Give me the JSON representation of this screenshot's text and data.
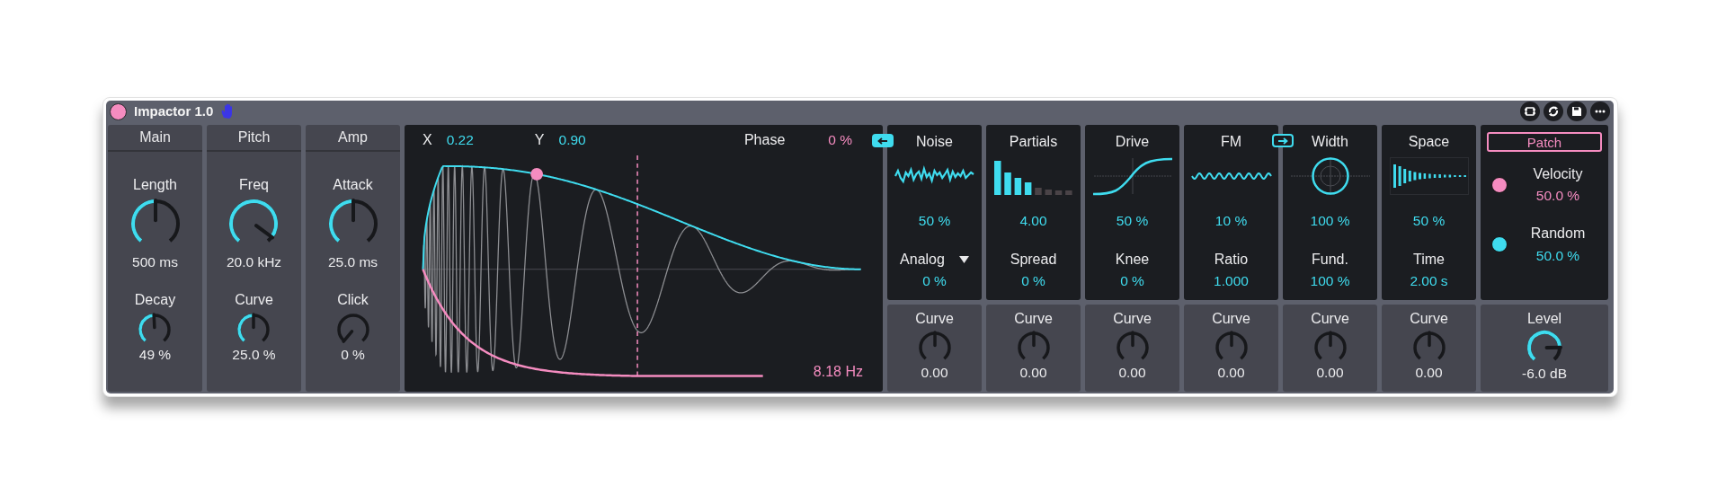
{
  "device": {
    "title": "Impactor 1.0",
    "on": true
  },
  "sections": [
    {
      "title": "Main",
      "knobs": [
        {
          "label": "Length",
          "reading": "500 ms"
        },
        {
          "label": "Decay",
          "reading": "49 %"
        }
      ]
    },
    {
      "title": "Pitch",
      "knobs": [
        {
          "label": "Freq",
          "reading": "20.0 kHz"
        },
        {
          "label": "Curve",
          "reading": "25.0 %"
        }
      ]
    },
    {
      "title": "Amp",
      "knobs": [
        {
          "label": "Attack",
          "reading": "25.0 ms"
        },
        {
          "label": "Click",
          "reading": "0 %"
        }
      ]
    }
  ],
  "display": {
    "x_label": "X",
    "x_value": "0.22",
    "y_label": "Y",
    "y_value": "0.90",
    "phase_label": "Phase",
    "phase_value": "0 %",
    "frequency": "8.18 Hz"
  },
  "modules": [
    {
      "title": "Noise",
      "kind": "noise",
      "value": "50 %",
      "param": {
        "kind": "dropdown",
        "label": "Analog",
        "value": "0 %"
      },
      "curve": {
        "label": "Curve",
        "value": "0.00"
      },
      "toggle": {
        "kind": "left",
        "on": true
      }
    },
    {
      "title": "Partials",
      "kind": "partials",
      "value": "4.00",
      "param": {
        "kind": "plain",
        "label": "Spread",
        "value": "0 %"
      },
      "curve": {
        "label": "Curve",
        "value": "0.00"
      }
    },
    {
      "title": "Drive",
      "kind": "drive",
      "value": "50 %",
      "param": {
        "kind": "plain",
        "label": "Knee",
        "value": "0 %"
      },
      "curve": {
        "label": "Curve",
        "value": "0.00"
      }
    },
    {
      "title": "FM",
      "kind": "fm",
      "value": "10 %",
      "param": {
        "kind": "plain",
        "label": "Ratio",
        "value": "1.000"
      },
      "curve": {
        "label": "Curve",
        "value": "0.00"
      },
      "toggle": {
        "kind": "right",
        "on": false
      }
    },
    {
      "title": "Width",
      "kind": "width",
      "value": "100 %",
      "param": {
        "kind": "plain",
        "label": "Fund.",
        "value": "100 %"
      },
      "curve": {
        "label": "Curve",
        "value": "0.00"
      }
    },
    {
      "title": "Space",
      "kind": "space",
      "value": "50 %",
      "param": {
        "kind": "plain",
        "label": "Time",
        "value": "2.00 s"
      },
      "curve": {
        "label": "Curve",
        "value": "0.00"
      }
    }
  ],
  "patch": {
    "button": "Patch",
    "mods": [
      {
        "label": "Velocity",
        "value": "50.0 %",
        "color": "#f58cc0"
      },
      {
        "label": "Random",
        "value": "50.0 %",
        "color": "#3fdcef"
      }
    ],
    "output": {
      "label": "Level",
      "value": "-6.0 dB"
    }
  }
}
